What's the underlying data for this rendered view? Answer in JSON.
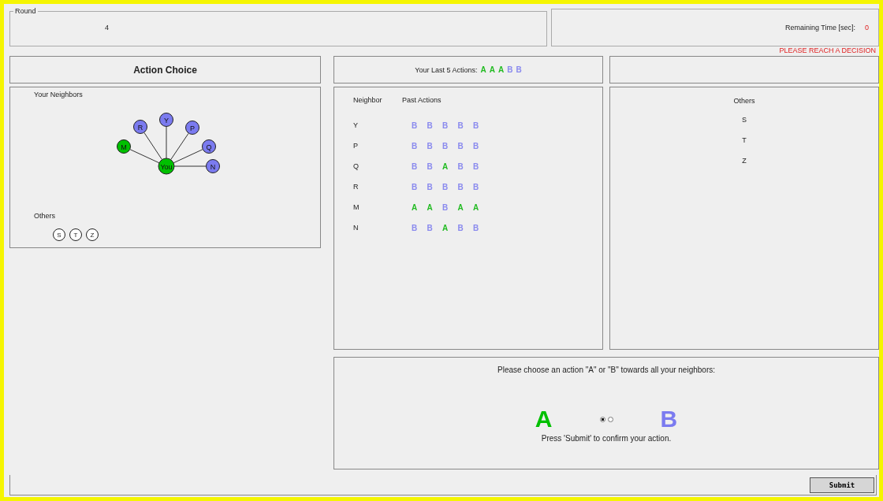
{
  "round": {
    "legend": "Round",
    "value": "4"
  },
  "timer": {
    "label": "Remaining Time [sec]:",
    "value": "0"
  },
  "warning": "PLEASE REACH A DECISION",
  "action_choice": {
    "title": "Action Choice"
  },
  "last_actions": {
    "label": "Your Last 5 Actions:",
    "actions": [
      {
        "label": "A",
        "color": "#22bb22"
      },
      {
        "label": "A",
        "color": "#22bb22"
      },
      {
        "label": "A",
        "color": "#22bb22"
      },
      {
        "label": "B",
        "color": "#8a8aee"
      },
      {
        "label": "B",
        "color": "#8a8aee"
      }
    ]
  },
  "network": {
    "title": "Your Neighbors",
    "center": {
      "label": "You",
      "color": "#00c000"
    },
    "neighbors": [
      {
        "label": "M",
        "color": "#00c000"
      },
      {
        "label": "R",
        "color": "#7b7bf0"
      },
      {
        "label": "Y",
        "color": "#7b7bf0"
      },
      {
        "label": "P",
        "color": "#7b7bf0"
      },
      {
        "label": "Q",
        "color": "#7b7bf0"
      },
      {
        "label": "N",
        "color": "#7b7bf0"
      }
    ],
    "others_title": "Others",
    "others": [
      "S",
      "T",
      "Z"
    ]
  },
  "history": {
    "columns": [
      "Neighbor",
      "Past Actions"
    ],
    "rows": [
      {
        "neighbor": "Y",
        "actions": [
          {
            "label": "B",
            "color": "#8a8aee"
          },
          {
            "label": "B",
            "color": "#8a8aee"
          },
          {
            "label": "B",
            "color": "#8a8aee"
          },
          {
            "label": "B",
            "color": "#8a8aee"
          },
          {
            "label": "B",
            "color": "#8a8aee"
          }
        ]
      },
      {
        "neighbor": "P",
        "actions": [
          {
            "label": "B",
            "color": "#8a8aee"
          },
          {
            "label": "B",
            "color": "#8a8aee"
          },
          {
            "label": "B",
            "color": "#8a8aee"
          },
          {
            "label": "B",
            "color": "#8a8aee"
          },
          {
            "label": "B",
            "color": "#8a8aee"
          }
        ]
      },
      {
        "neighbor": "Q",
        "actions": [
          {
            "label": "B",
            "color": "#8a8aee"
          },
          {
            "label": "B",
            "color": "#8a8aee"
          },
          {
            "label": "A",
            "color": "#22bb22"
          },
          {
            "label": "B",
            "color": "#8a8aee"
          },
          {
            "label": "B",
            "color": "#8a8aee"
          }
        ]
      },
      {
        "neighbor": "R",
        "actions": [
          {
            "label": "B",
            "color": "#8a8aee"
          },
          {
            "label": "B",
            "color": "#8a8aee"
          },
          {
            "label": "B",
            "color": "#8a8aee"
          },
          {
            "label": "B",
            "color": "#8a8aee"
          },
          {
            "label": "B",
            "color": "#8a8aee"
          }
        ]
      },
      {
        "neighbor": "M",
        "actions": [
          {
            "label": "A",
            "color": "#22bb22"
          },
          {
            "label": "A",
            "color": "#22bb22"
          },
          {
            "label": "B",
            "color": "#8a8aee"
          },
          {
            "label": "A",
            "color": "#22bb22"
          },
          {
            "label": "A",
            "color": "#22bb22"
          }
        ]
      },
      {
        "neighbor": "N",
        "actions": [
          {
            "label": "B",
            "color": "#8a8aee"
          },
          {
            "label": "B",
            "color": "#8a8aee"
          },
          {
            "label": "A",
            "color": "#22bb22"
          },
          {
            "label": "B",
            "color": "#8a8aee"
          },
          {
            "label": "B",
            "color": "#8a8aee"
          }
        ]
      }
    ]
  },
  "others_list": {
    "title": "Others",
    "items": [
      "S",
      "T",
      "Z"
    ]
  },
  "choice": {
    "prompt": "Please choose an action \"A\" or \"B\"  towards all your neighbors:",
    "options": [
      {
        "label": "A",
        "color": "#00c000",
        "selected": true
      },
      {
        "label": "B",
        "color": "#7b7bf0",
        "selected": false
      }
    ],
    "hint": "Press 'Submit' to confirm your action."
  },
  "submit": "Submit"
}
